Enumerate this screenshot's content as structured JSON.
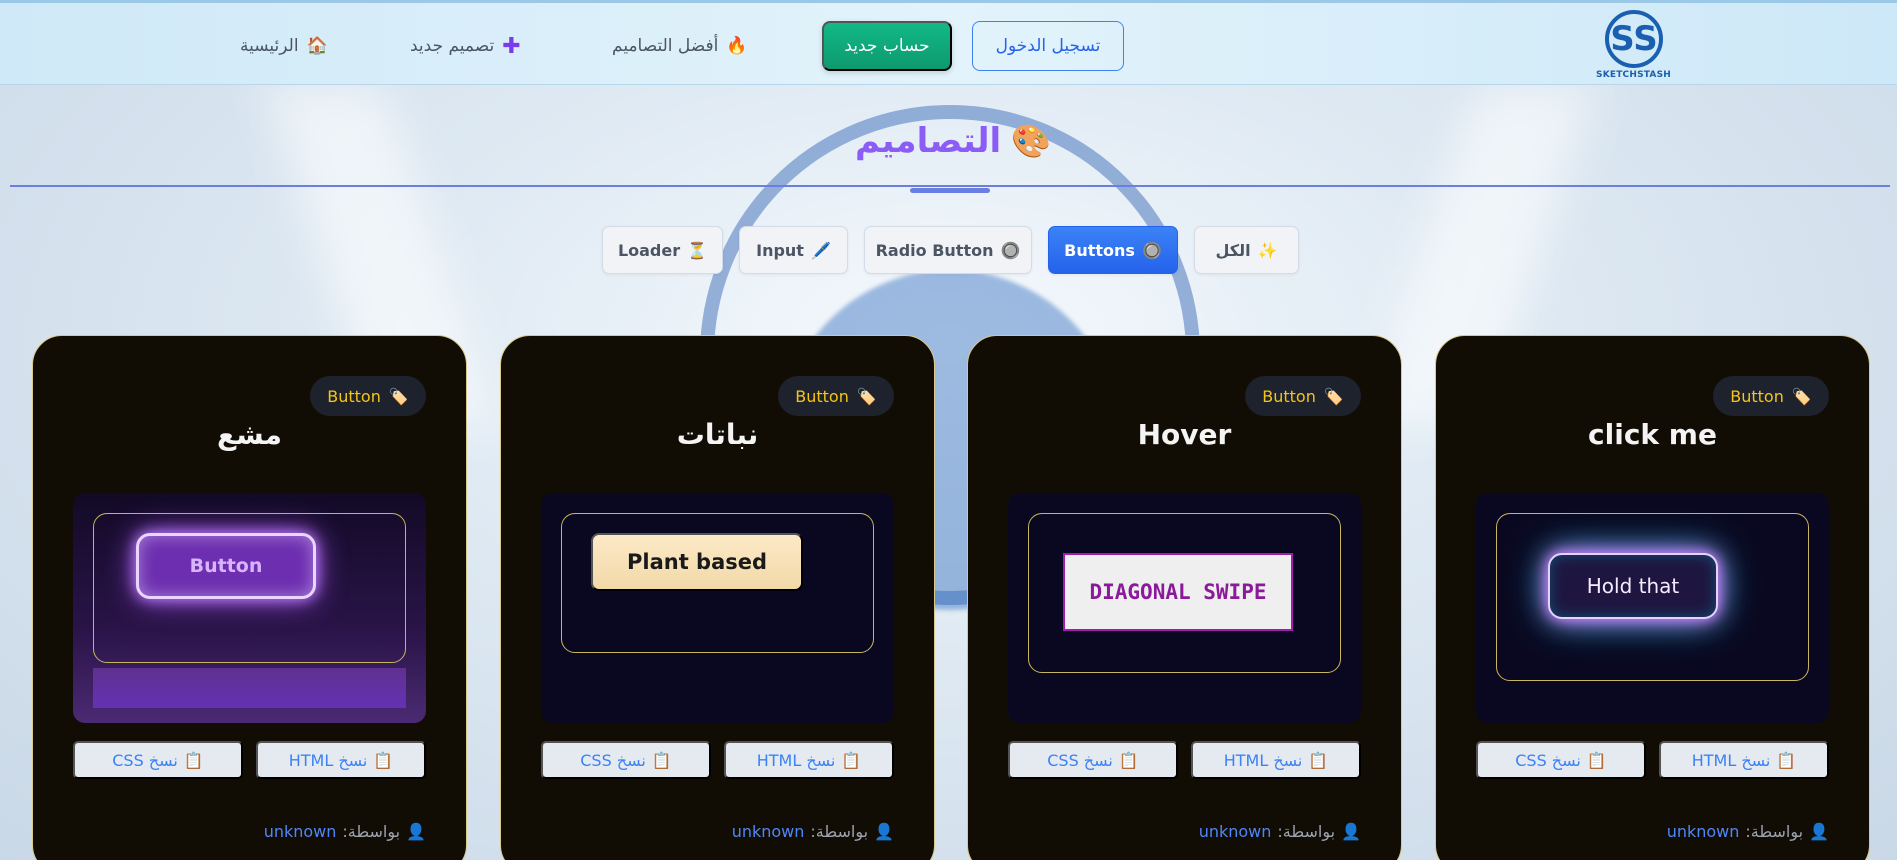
{
  "header": {
    "logo_text": "SKETCHSTASH",
    "logo_mark": "SS",
    "login_label": "تسجيل الدخول",
    "signup_label": "حساب جديد",
    "nav": [
      {
        "icon": "fire-icon",
        "glyph": "🔥",
        "label": "أفضل التصاميم"
      },
      {
        "icon": "plus-icon",
        "glyph": "✚",
        "label": "تصميم جديد"
      },
      {
        "icon": "home-icon",
        "glyph": "🏠",
        "label": "الرئيسية"
      }
    ]
  },
  "page": {
    "title": "التصاميم",
    "title_icon": "🎨",
    "accent_color": "#8b5cf6"
  },
  "filters": [
    {
      "label": "الكل",
      "icon": "✨",
      "active": false
    },
    {
      "label": "Buttons",
      "icon": "🔘",
      "active": true
    },
    {
      "label": "Radio Button",
      "icon": "🔘",
      "active": false
    },
    {
      "label": "Input",
      "icon": "🖊️",
      "active": false
    },
    {
      "label": "Loader",
      "icon": "⏳",
      "active": false
    }
  ],
  "cards": [
    {
      "tag": "Button",
      "tag_icon": "🏷️",
      "title": "click me",
      "demo_label": "Hold that",
      "copy_html": "نسخ HTML",
      "copy_css": "نسخ CSS",
      "author_prefix": "بواسطة:",
      "author": "unknown"
    },
    {
      "tag": "Button",
      "tag_icon": "🏷️",
      "title": "Hover",
      "demo_label": "DIAGONAL SWIPE",
      "copy_html": "نسخ HTML",
      "copy_css": "نسخ CSS",
      "author_prefix": "بواسطة:",
      "author": "unknown"
    },
    {
      "tag": "Button",
      "tag_icon": "🏷️",
      "title": "نباتات",
      "demo_label": "Plant based",
      "copy_html": "نسخ HTML",
      "copy_css": "نسخ CSS",
      "author_prefix": "بواسطة:",
      "author": "unknown"
    },
    {
      "tag": "Button",
      "tag_icon": "🏷️",
      "title": "مشع",
      "demo_label": "Button",
      "copy_html": "نسخ HTML",
      "copy_css": "نسخ CSS",
      "author_prefix": "بواسطة:",
      "author": "unknown"
    }
  ],
  "icons": {
    "copy": "📋",
    "user": "👤"
  }
}
